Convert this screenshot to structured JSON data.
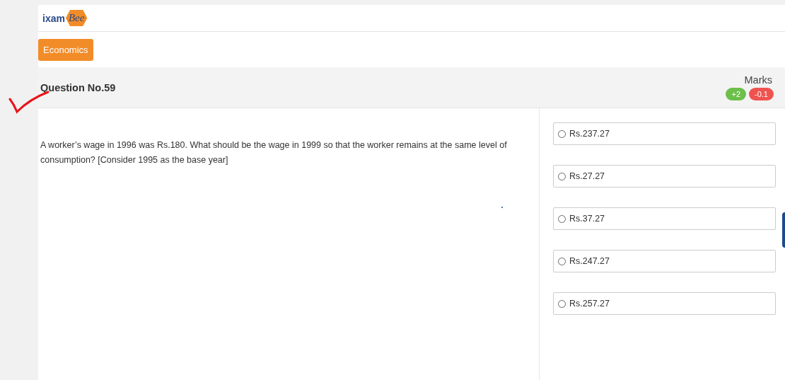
{
  "logo": {
    "prefix": "ixam",
    "emblem": "Bee"
  },
  "subject": {
    "label": "Economics"
  },
  "question": {
    "title": "Question No.59",
    "marks_label": "Marks",
    "positive": "+2",
    "negative": "-0.1",
    "text": "A worker’s wage in 1996 was Rs.180. What should be the wage in 1999 so that the worker remains at the same level of consumption? [Consider 1995 as the base year]"
  },
  "options": [
    {
      "label": "Rs.237.27",
      "selected": false
    },
    {
      "label": "Rs.27.27",
      "selected": false
    },
    {
      "label": "Rs.37.27",
      "selected": false
    },
    {
      "label": "Rs.247.27",
      "selected": false
    },
    {
      "label": "Rs.257.27",
      "selected": false
    }
  ]
}
